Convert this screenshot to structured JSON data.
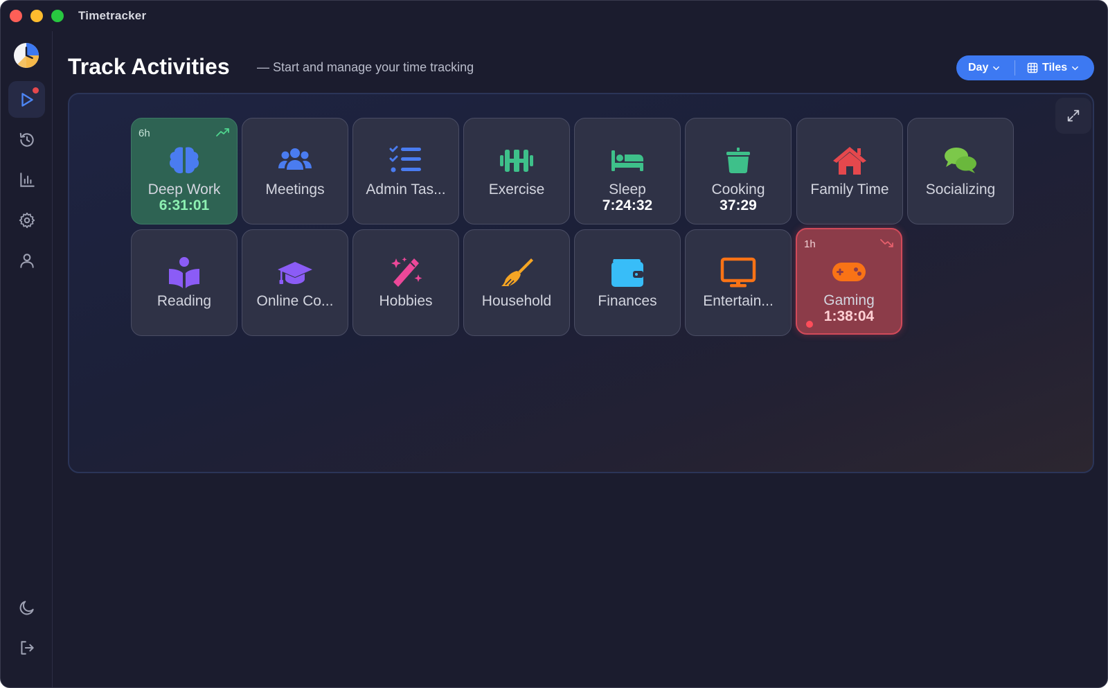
{
  "window": {
    "title": "Timetracker"
  },
  "sidebar": {
    "items": [
      {
        "id": "track",
        "icon": "play-icon",
        "active": true,
        "badge": true
      },
      {
        "id": "history",
        "icon": "history-icon"
      },
      {
        "id": "stats",
        "icon": "bar-chart-icon"
      },
      {
        "id": "settings",
        "icon": "gear-icon"
      },
      {
        "id": "profile",
        "icon": "user-icon"
      }
    ],
    "bottom": [
      {
        "id": "theme",
        "icon": "moon-icon"
      },
      {
        "id": "logout",
        "icon": "logout-icon"
      }
    ]
  },
  "header": {
    "title": "Track Activities",
    "subtitle": "— Start and manage your time tracking"
  },
  "controls": {
    "period": "Day",
    "view": "Tiles"
  },
  "colors": {
    "accent": "#3d79f2",
    "goal_met": "#2e6353",
    "goal_missed": "#8c3c49",
    "recording": "#ff4d5a"
  },
  "activities": [
    {
      "name": "Deep Work",
      "icon": "brain-icon",
      "color": "#4a7cf0",
      "timer": "6:31:01",
      "goal": "6h",
      "trend": "up",
      "state": "goal-met"
    },
    {
      "name": "Meetings",
      "icon": "users-icon",
      "color": "#4a7cf0"
    },
    {
      "name": "Admin Tas...",
      "icon": "list-check-icon",
      "color": "#4a7cf0"
    },
    {
      "name": "Exercise",
      "icon": "dumbbell-icon",
      "color": "#3ec08a"
    },
    {
      "name": "Sleep",
      "icon": "bed-icon",
      "color": "#3ec08a",
      "timer": "7:24:32"
    },
    {
      "name": "Cooking",
      "icon": "pot-icon",
      "color": "#3ec08a",
      "timer": "37:29"
    },
    {
      "name": "Family Time",
      "icon": "house-icon",
      "color": "#e5484d"
    },
    {
      "name": "Socializing",
      "icon": "chat-icon",
      "color": "#7cc84a"
    },
    {
      "name": "Reading",
      "icon": "book-reader-icon",
      "color": "#8b5cf6"
    },
    {
      "name": "Online Co...",
      "icon": "graduation-cap-icon",
      "color": "#8b5cf6"
    },
    {
      "name": "Hobbies",
      "icon": "magic-wand-icon",
      "color": "#ec4899"
    },
    {
      "name": "Household",
      "icon": "broom-icon",
      "color": "#f5a524"
    },
    {
      "name": "Finances",
      "icon": "wallet-icon",
      "color": "#38bdf8"
    },
    {
      "name": "Entertain...",
      "icon": "tv-icon",
      "color": "#f97316"
    },
    {
      "name": "Gaming",
      "icon": "gamepad-icon",
      "color": "#f97316",
      "timer": "1:38:04",
      "goal": "1h",
      "trend": "down",
      "state": "goal-exceeded",
      "recording": true
    }
  ]
}
